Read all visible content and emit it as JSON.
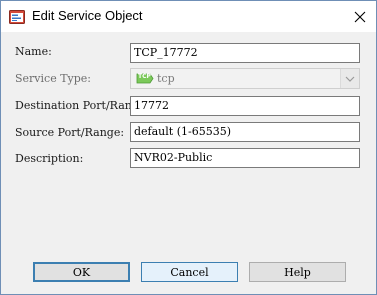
{
  "window": {
    "title": "Edit Service Object"
  },
  "form": {
    "name_label": "Name:",
    "name_value": "TCP_17772",
    "service_type_label": "Service Type:",
    "service_type_value": "tcp",
    "service_type_badge": "TCP",
    "dest_port_label": "Destination Port/Range:",
    "dest_port_value": "17772",
    "source_port_label": "Source Port/Range:",
    "source_port_value": "default (1-65535)",
    "description_label": "Description:",
    "description_value": "NVR02-Public"
  },
  "buttons": {
    "ok": "OK",
    "cancel": "Cancel",
    "help": "Help"
  },
  "icons": {
    "app": "service-object-icon",
    "close": "close-icon",
    "protocol": "tcp-protocol-icon",
    "dropdown": "chevron-down-icon"
  },
  "colors": {
    "accent": "#3c7fb1",
    "protocol_badge": "#7cc95a"
  }
}
